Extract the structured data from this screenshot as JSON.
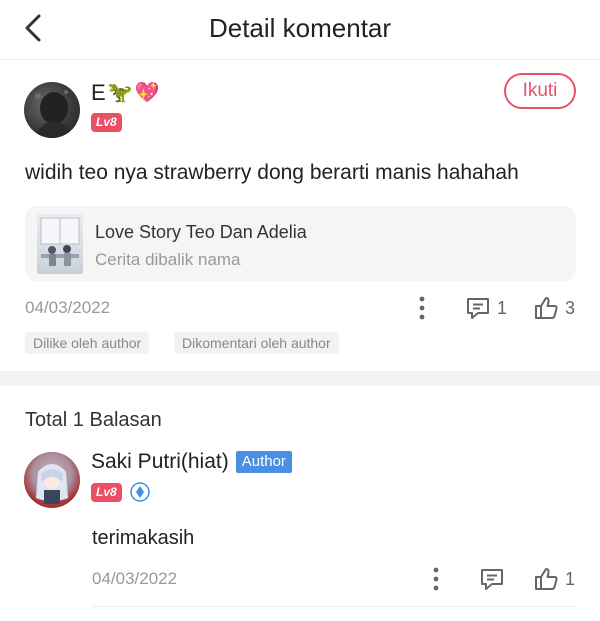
{
  "header": {
    "title": "Detail komentar"
  },
  "comment": {
    "username": "E",
    "emojis": [
      "🦖",
      "💖"
    ],
    "level": "Lv8",
    "follow_label": "Ikuti",
    "text": "widih teo nya strawberry dong berarti manis hahahah",
    "story": {
      "title": "Love Story Teo Dan Adelia",
      "subtitle": "Cerita dibalik nama"
    },
    "date": "04/03/2022",
    "reply_count": "1",
    "like_count": "3",
    "tags": [
      "Dilike oleh author",
      "Dikomentari oleh author"
    ]
  },
  "replies": {
    "total_label": "Total 1 Balasan",
    "items": [
      {
        "username": "Saki Putri(hiat)",
        "badge": "Author",
        "level": "Lv8",
        "text": "terimakasih",
        "date": "04/03/2022",
        "like_count": "1"
      }
    ]
  },
  "colors": {
    "accent": "#e5536a",
    "level_bg": "#ec4f63",
    "author_badge": "#4a90e2",
    "muted": "#999999"
  },
  "icons": [
    "back-arrow-icon",
    "more-vertical-icon",
    "comment-icon",
    "thumbs-up-icon",
    "verified-shield-icon"
  ]
}
